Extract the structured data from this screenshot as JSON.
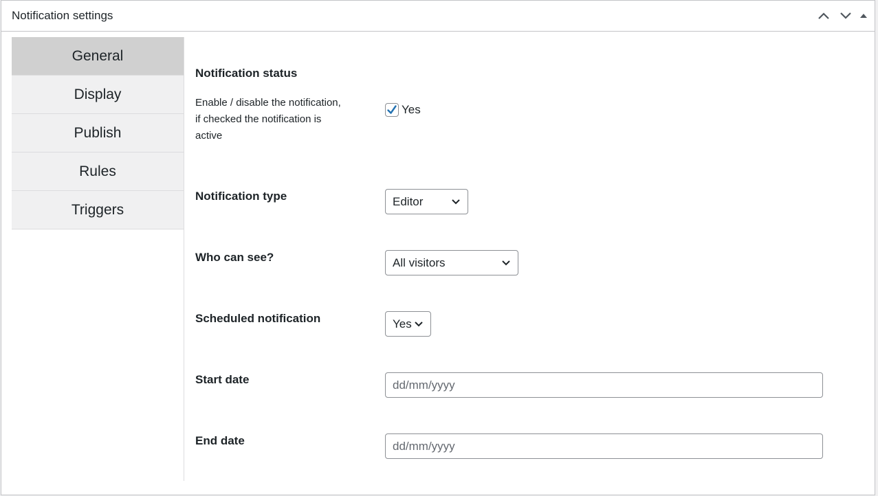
{
  "header": {
    "title": "Notification settings"
  },
  "tabs": [
    {
      "label": "General",
      "active": true
    },
    {
      "label": "Display",
      "active": false
    },
    {
      "label": "Publish",
      "active": false
    },
    {
      "label": "Rules",
      "active": false
    },
    {
      "label": "Triggers",
      "active": false
    }
  ],
  "general": {
    "status": {
      "label": "Notification status",
      "description": "Enable / disable the notification, if checked the notification is active",
      "checkbox_label": "Yes",
      "checked": true
    },
    "type": {
      "label": "Notification type",
      "value": "Editor"
    },
    "visibility": {
      "label": "Who can see?",
      "value": "All visitors"
    },
    "scheduled": {
      "label": "Scheduled notification",
      "value": "Yes"
    },
    "start_date": {
      "label": "Start date",
      "placeholder": "dd/mm/yyyy"
    },
    "end_date": {
      "label": "End date",
      "placeholder": "dd/mm/yyyy"
    }
  },
  "colors": {
    "accent": "#2271b1",
    "active_tab": "#d0d0d0",
    "tab_bg": "#f0f0f1",
    "border": "#c3c4c7"
  }
}
